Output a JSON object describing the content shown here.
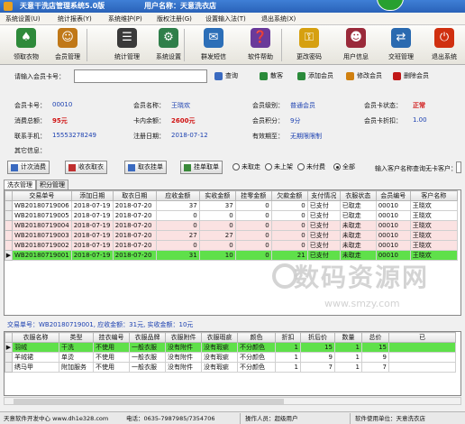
{
  "window": {
    "title": "天意干洗店管理系统5.0版",
    "store_name": "用户名称：天意洗衣店"
  },
  "menu": [
    "系统设置(U)",
    "统计报表(Y)",
    "系统维护(P)",
    "版权注册(G)",
    "设置输入法(T)",
    "退出系统(X)"
  ],
  "toolbar": [
    {
      "label": "领取衣物",
      "icon": "clothes-icon",
      "color": "#2e8a3a"
    },
    {
      "label": "会员管理",
      "icon": "members-icon",
      "color": "#c07818"
    },
    {
      "label": "统计管理",
      "icon": "stats-icon",
      "color": "#3a3a3a"
    },
    {
      "label": "系统设置",
      "icon": "settings-icon",
      "color": "#2f7f4a"
    },
    {
      "label": "群发短信",
      "icon": "sms-icon",
      "color": "#2c6fb8"
    },
    {
      "label": "软件帮助",
      "icon": "help-icon",
      "color": "#6a3a9a"
    },
    {
      "label": "更改密码",
      "icon": "key-icon",
      "color": "#d6a010"
    },
    {
      "label": "用户信息",
      "icon": "user-info-icon",
      "color": "#9a2a3a"
    },
    {
      "label": "交班管理",
      "icon": "handover-icon",
      "color": "#2a6ab0"
    },
    {
      "label": "退出系统",
      "icon": "exit-icon",
      "color": "#d03010"
    }
  ],
  "search": {
    "label": "请输入会员卡号：",
    "value": "",
    "buttons": [
      {
        "label": "查询",
        "icon": "search-icon",
        "color": "#3a6ac0"
      },
      {
        "label": "散客",
        "icon": "guest-icon",
        "color": "#2a8a3a"
      },
      {
        "label": "添加会员",
        "icon": "add-member-icon",
        "color": "#2a8a3a"
      },
      {
        "label": "修改会员",
        "icon": "edit-member-icon",
        "color": "#d08010"
      },
      {
        "label": "删除会员",
        "icon": "delete-member-icon",
        "color": "#c01818"
      }
    ]
  },
  "member": {
    "card_no_label": "会员卡号：",
    "card_no": "00010",
    "name_label": "会员名称：",
    "name": "王晓欢",
    "level_label": "会员级别：",
    "level": "普通会员",
    "card_status_label": "会员卡状态：",
    "card_status": "正常",
    "total_label": "消费总额：",
    "total": "95元",
    "balance_label": "卡内余额：",
    "balance": "2600元",
    "points_label": "会员积分：",
    "points": "9分",
    "discount_label": "会员卡折扣：",
    "discount": "1.00",
    "phone_label": "联系手机：",
    "phone": "15553278249",
    "reg_label": "注册日期：",
    "reg_date": "2018-07-12",
    "expire_label": "有效期至：",
    "expire": "无期限限制",
    "other_label": "其它信息："
  },
  "actions": {
    "buttons": [
      {
        "label": "计次消费",
        "icon": "count-icon",
        "color": "#3a6ac0"
      },
      {
        "label": "收衣取衣",
        "icon": "receive-icon",
        "color": "#c03030"
      },
      {
        "label": "取衣挂单",
        "icon": "pickup-icon",
        "color": "#3a6ac0"
      },
      {
        "label": "挂单取单",
        "icon": "order-icon",
        "color": "#3a8a3a"
      }
    ],
    "filters": [
      "未取走",
      "未上架",
      "未付费",
      "全部"
    ],
    "selected_filter": "全部",
    "search_hint": "输入客户名称查询无卡客户："
  },
  "tabs": [
    "洗衣管理",
    "积分管理"
  ],
  "orders": {
    "columns": [
      "交易单号",
      "添加日期",
      "取衣日期",
      "应收金额",
      "实收金额",
      "挂零金额",
      "欠款金额",
      "支付情况",
      "衣服状态",
      "会员编号",
      "客户名称"
    ],
    "rows": [
      {
        "style": "",
        "cells": [
          "WB20180719006",
          "2018-07-19",
          "2018-07-20",
          "37",
          "37",
          "0",
          "0",
          "已支付",
          "已取走",
          "00010",
          "王晓欢"
        ]
      },
      {
        "style": "",
        "cells": [
          "WB20180719005",
          "2018-07-19",
          "2018-07-20",
          "0",
          "0",
          "0",
          "0",
          "已支付",
          "已取走",
          "00010",
          "王晓欢"
        ]
      },
      {
        "style": "pink",
        "cells": [
          "WB20180719004",
          "2018-07-19",
          "2018-07-20",
          "0",
          "0",
          "0",
          "0",
          "已支付",
          "未取走",
          "00010",
          "王晓欢"
        ]
      },
      {
        "style": "pink",
        "cells": [
          "WB20180719003",
          "2018-07-19",
          "2018-07-20",
          "27",
          "27",
          "0",
          "0",
          "已支付",
          "未取走",
          "00010",
          "王晓欢"
        ]
      },
      {
        "style": "pink",
        "cells": [
          "WB20180719002",
          "2018-07-19",
          "2018-07-20",
          "0",
          "0",
          "0",
          "0",
          "已支付",
          "未取走",
          "00010",
          "王晓欢"
        ]
      },
      {
        "style": "green",
        "cells": [
          "WB20180719001",
          "2018-07-19",
          "2018-07-20",
          "31",
          "10",
          "0",
          "21",
          "已支付",
          "未取走",
          "00010",
          "王晓欢"
        ]
      }
    ]
  },
  "summary": "交易单号：WB20180719001, 应收金额：31元, 实收金额：10元",
  "items": {
    "columns": [
      "衣服名称",
      "类型",
      "挂衣编号",
      "衣服品牌",
      "衣服附件",
      "衣服瑕疵",
      "颜色",
      "折扣",
      "折后价",
      "数量",
      "总价",
      "已"
    ],
    "rows": [
      {
        "style": "green",
        "cells": [
          "羽绒",
          "干洗",
          "不使用",
          "一般衣服",
          "没有附件",
          "没有瑕疵",
          "不分颜色",
          "1",
          "15",
          "1",
          "15",
          ""
        ]
      },
      {
        "style": "",
        "cells": [
          "羊绒裙",
          "单烫",
          "不使用",
          "一般衣服",
          "没有附件",
          "没有瑕疵",
          "不分颜色",
          "1",
          "9",
          "1",
          "9",
          ""
        ]
      },
      {
        "style": "",
        "cells": [
          "绣马甲",
          "附加服务",
          "不使用",
          "一般衣服",
          "没有附件",
          "没有瑕疵",
          "不分颜色",
          "1",
          "7",
          "1",
          "7",
          ""
        ]
      }
    ]
  },
  "watermark": {
    "big": "数码资源网",
    "small": "www.smzy.com"
  },
  "status": {
    "website": "天意软件开发中心 www.dh1e328.com",
    "phone": "电话：0635-7987985/7354706",
    "operator": "操作人员：超级用户",
    "unit": "软件使用单位：天意洗衣店"
  }
}
